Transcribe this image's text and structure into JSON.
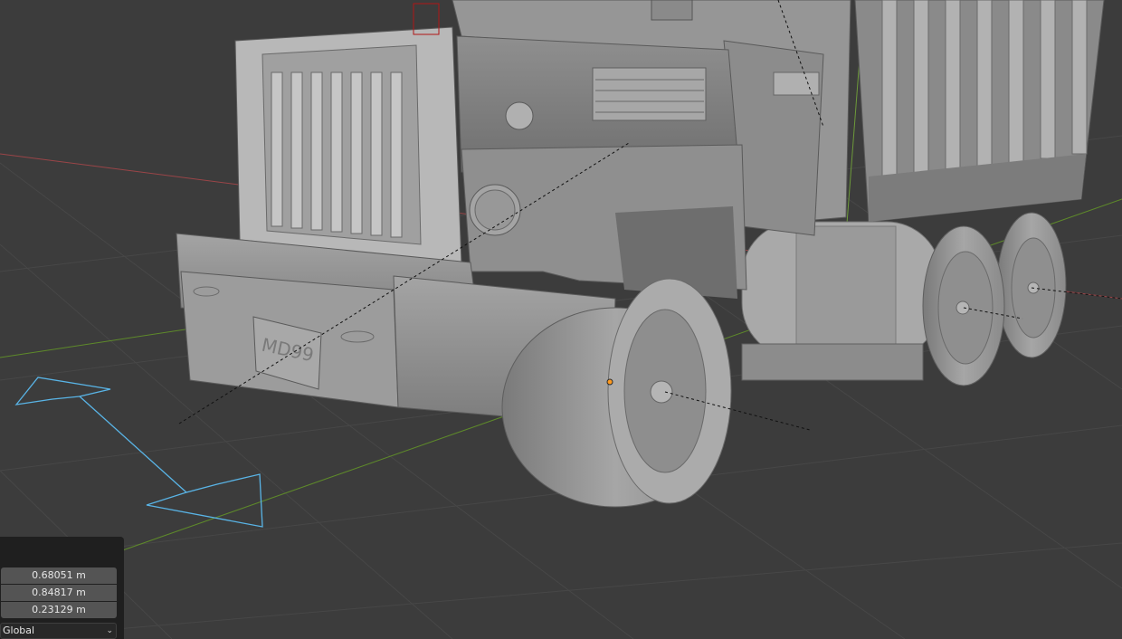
{
  "app": "Blender 3D Viewport",
  "gizmo": {
    "icon": "move-arrow-icon",
    "color": "#59b4e6"
  },
  "colors": {
    "x_axis": "#9a4548",
    "y_axis": "#5e8a2a",
    "z_axis": "#6d9a3a",
    "origin": "#ff9a1f",
    "grid": "#474747",
    "background": "#3c3c3c"
  },
  "model": {
    "plate_text": "MD99"
  },
  "redo_panel": {
    "fields": [
      {
        "value": "0.68051 m"
      },
      {
        "value": "0.84817 m"
      },
      {
        "value": "0.23129 m"
      }
    ],
    "orientation": "Global"
  }
}
